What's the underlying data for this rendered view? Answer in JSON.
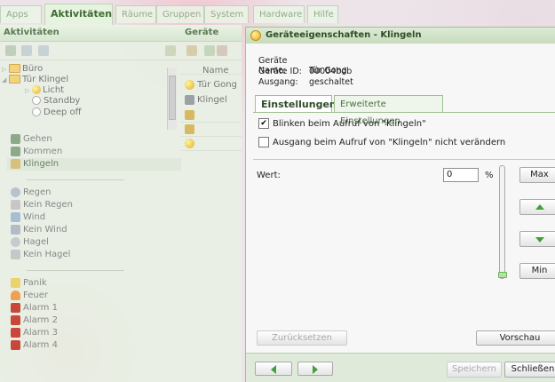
{
  "top_tabs": [
    "Apps",
    "Aktivitäten",
    "Räume",
    "Gruppen",
    "System",
    "Hardware",
    "Hilfe"
  ],
  "left_panel": {
    "title": "Aktivitäten",
    "tree": [
      {
        "label": "Büro",
        "type": "folder",
        "expanded": false
      },
      {
        "label": "Tür Klingel",
        "type": "folder",
        "expanded": true
      },
      {
        "label": "Licht",
        "type": "bulb",
        "expanded": false
      },
      {
        "label": "Standby",
        "type": "radio"
      },
      {
        "label": "Deep off",
        "type": "radio"
      }
    ],
    "activities_group1": [
      "Gehen",
      "Kommen",
      "Klingeln"
    ],
    "selected_activity": "Klingeln",
    "activities_group2": [
      "Regen",
      "Kein Regen",
      "Wind",
      "Kein Wind",
      "Hagel",
      "Kein Hagel"
    ],
    "activities_group3": [
      "Panik",
      "Feuer",
      "Alarm 1",
      "Alarm 2",
      "Alarm 3",
      "Alarm 4"
    ]
  },
  "geraete_panel": {
    "title": "Geräte",
    "column_header": "Name",
    "items": [
      "Tür Gong",
      "Klingel"
    ]
  },
  "dialog": {
    "title": "Geräteeigenschaften - Klingeln",
    "info": [
      {
        "key": "Geräte Name:",
        "value": "Tür Gong"
      },
      {
        "key": "Geräte ID:",
        "value": "00004bdb"
      },
      {
        "key": "Ausgang:",
        "value": "geschaltet"
      }
    ],
    "tabs": [
      "Einstellungen",
      "Erweiterte Einstellungen"
    ],
    "active_tab": "Einstellungen",
    "checkbox_blink": {
      "label": "Blinken beim Aufruf von \"Klingeln\"",
      "checked": true
    },
    "checkbox_output": {
      "label": "Ausgang beim Aufruf von \"Klingeln\" nicht verändern",
      "checked": false
    },
    "value_label": "Wert:",
    "value": "0",
    "unit": "%",
    "slider_level": 0,
    "buttons": {
      "max": "Max",
      "min": "Min",
      "reset": "Zurücksetzen",
      "preview": "Vorschau",
      "save": "Speichern",
      "close": "Schließen"
    }
  },
  "colors": {
    "accent_green": "#3fa23a",
    "panel_header": "#5b7a52",
    "dialog_border": "#9fc092"
  }
}
